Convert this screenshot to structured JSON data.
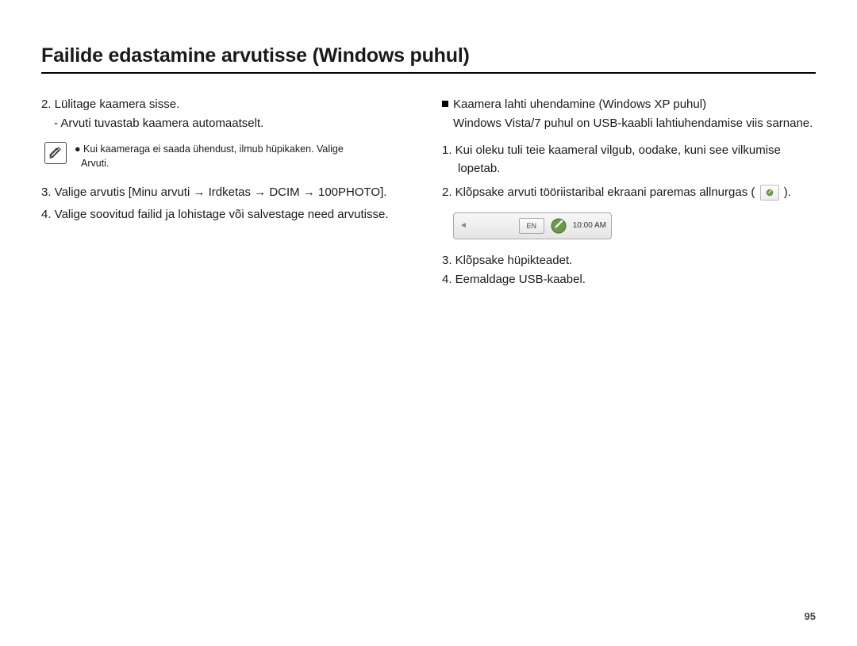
{
  "title": "Failide edastamine arvutisse (Windows puhul)",
  "page_number": "95",
  "left": {
    "step2": "2. Lülitage kaamera sisse.",
    "step2sub": "- Arvuti tuvastab kaamera automaatselt.",
    "note_line1": "● Kui kaameraga ei saada ühendust, ilmub hüpikaken. Valige",
    "note_line2": "Arvuti.",
    "step3": "3. Valige arvutis [Minu arvuti → Irdketas → DCIM → 100PHOTO].",
    "step4": "4. Valige soovitud failid ja lohistage või salvestage need arvutisse."
  },
  "right": {
    "subhead_title": "Kaamera lahti uhendamine (Windows XP puhul)",
    "subhead_body": "Windows Vista/7 puhul on USB-kaabli lahtiuhendamise viis sarnane.",
    "step1_l1": "1. Kui oleku tuli teie kaameral vilgub, oodake, kuni see vilkumise",
    "step1_l2": "lopetab.",
    "step2_pre": "2. Klõpsake arvuti tööriistaribal ekraani paremas allnurgas ( ",
    "step2_post": " ).",
    "taskbar_en": "EN",
    "taskbar_time": "10:00 AM",
    "step3": "3. Klõpsake hüpikteadet.",
    "step4": "4. Eemaldage USB-kaabel."
  }
}
